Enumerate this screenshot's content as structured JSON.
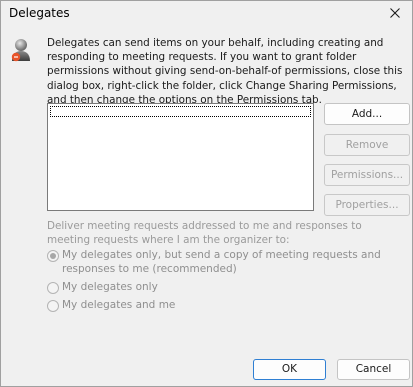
{
  "window": {
    "title": "Delegates"
  },
  "description": "Delegates can send items on your behalf, including creating and responding to meeting requests. If you want to grant folder permissions without giving send-on-behalf-of permissions, close this dialog box, right-click the folder, click Change Sharing Permissions, and then change the options on the Permissions tab.",
  "buttons": {
    "add": "Add...",
    "remove": "Remove",
    "permissions": "Permissions...",
    "properties": "Properties...",
    "ok": "OK",
    "cancel": "Cancel"
  },
  "delivery": {
    "label": "Deliver meeting requests addressed to me and responses to meeting requests where I am the organizer to:",
    "options": [
      {
        "label": "My delegates only, but send a copy of meeting requests and responses to me (recommended)",
        "checked": true
      },
      {
        "label": "My delegates only",
        "checked": false
      },
      {
        "label": "My delegates and me",
        "checked": false
      }
    ]
  },
  "icons": {
    "close": "close-icon",
    "delegates": "person-icon"
  }
}
